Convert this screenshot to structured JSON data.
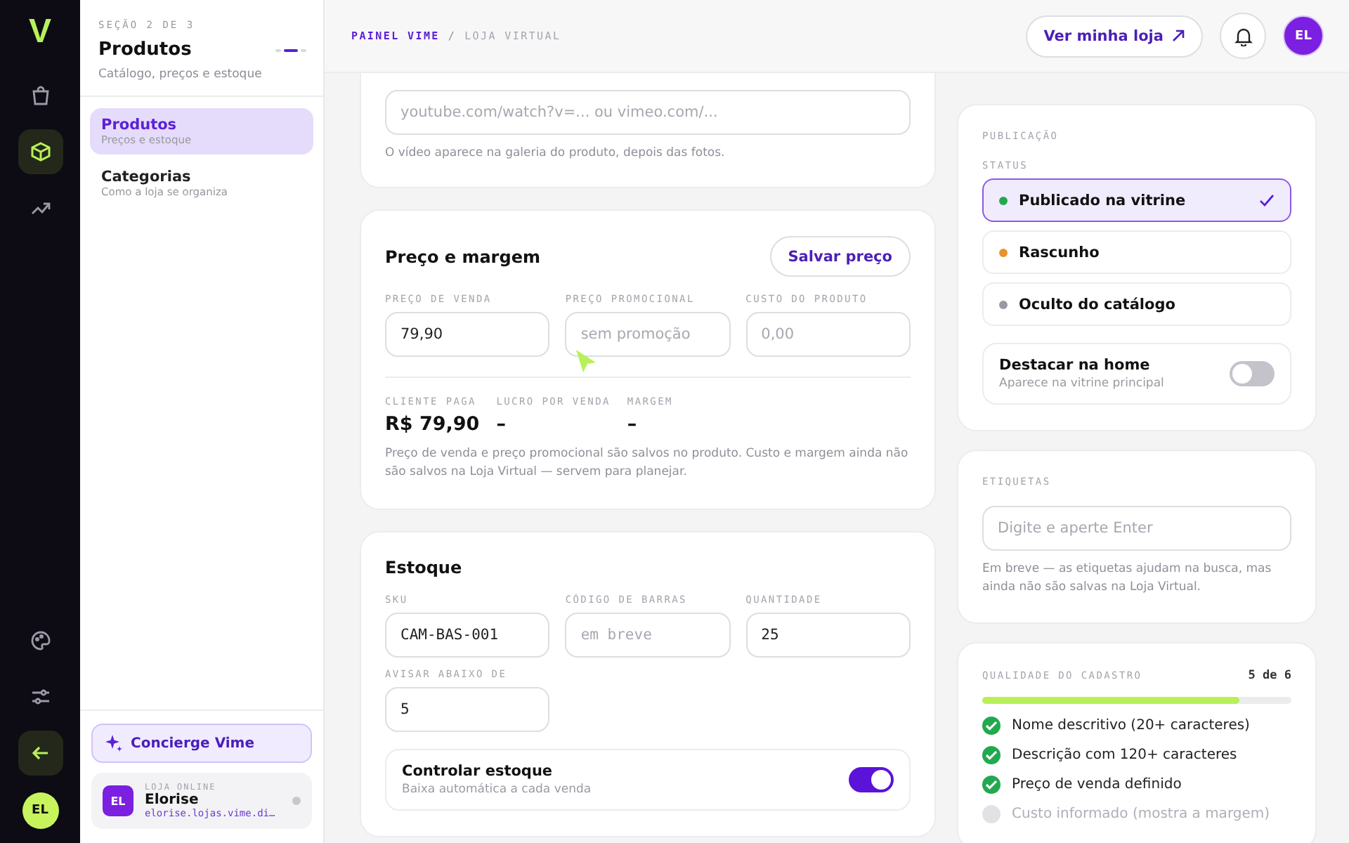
{
  "rail": {
    "logo": "V",
    "items": [
      {
        "kind": "bag",
        "selected": false
      },
      {
        "kind": "box",
        "selected": true
      },
      {
        "kind": "trend",
        "selected": false
      }
    ],
    "bottom_items": [
      {
        "kind": "palette",
        "selected": false
      },
      {
        "kind": "sliders",
        "selected": false
      },
      {
        "kind": "back",
        "selected": true
      }
    ],
    "avatar": "EL"
  },
  "sidebar": {
    "step": "SEÇÃO 2 DE 3",
    "title": "Produtos",
    "steps": [
      {
        "selected": false
      },
      {
        "selected": true
      },
      {
        "selected": false
      }
    ],
    "subtitle": "Catálogo, preços e estoque",
    "items": [
      {
        "label": "Produtos",
        "sub": "Preços e estoque",
        "selected": true
      },
      {
        "label": "Categorias",
        "sub": "Como a loja se organiza",
        "selected": false
      }
    ],
    "concierge": "Concierge Vime",
    "store": {
      "avatar": "EL",
      "kicker": "LOJA ONLINE",
      "name": "Elorise",
      "url": "elorise.lojas.vime.di…",
      "online": false
    }
  },
  "header": {
    "breadcrumb": [
      "PAINEL VIME",
      "/",
      "LOJA VIRTUAL"
    ],
    "view_store": "Ver minha loja",
    "avatar": "EL"
  },
  "video": {
    "placeholder": "youtube.com/watch?v=... ou vimeo.com/...",
    "help": "O vídeo aparece na galeria do produto, depois das fotos."
  },
  "price": {
    "title": "Preço e margem",
    "save": "Salvar preço",
    "fields": [
      {
        "label": "PREÇO DE VENDA",
        "value": "79,90"
      },
      {
        "label": "PREÇO PROMOCIONAL",
        "placeholder": "sem promoção"
      },
      {
        "label": "CUSTO DO PRODUTO",
        "placeholder": "0,00"
      }
    ],
    "stats": [
      {
        "label": "CLIENTE PAGA",
        "value": "R$ 79,90"
      },
      {
        "label": "LUCRO POR VENDA",
        "value": "–"
      },
      {
        "label": "MARGEM",
        "value": "–"
      }
    ],
    "note": "Preço de venda e preço promocional são salvos no produto. Custo e margem ainda não são salvos na Loja Virtual — servem para planejar."
  },
  "stock": {
    "title": "Estoque",
    "fields": [
      {
        "label": "SKU",
        "value": "CAM-BAS-001"
      },
      {
        "label": "CÓDIGO DE BARRAS",
        "placeholder": "em breve"
      },
      {
        "label": "QUANTIDADE",
        "value": "25"
      },
      {
        "label": "AVISAR ABAIXO DE",
        "value": "5"
      }
    ],
    "control": {
      "title": "Controlar estoque",
      "sub": "Baixa automática a cada venda",
      "on": true
    }
  },
  "publication": {
    "title": "PUBLICAÇÃO",
    "status_label": "STATUS",
    "statuses": [
      {
        "label": "Publicado na vitrine",
        "color": "#22a94f",
        "selected": true
      },
      {
        "label": "Rascunho",
        "color": "#e8922c",
        "selected": false
      },
      {
        "label": "Oculto do catálogo",
        "color": "#9a98a3",
        "selected": false
      }
    ],
    "highlight": {
      "title": "Destacar na home",
      "sub": "Aparece na vitrine principal",
      "on": false
    }
  },
  "tags": {
    "title": "ETIQUETAS",
    "placeholder": "Digite e aperte Enter",
    "help": "Em breve — as etiquetas ajudam na busca, mas ainda não são salvas na Loja Virtual."
  },
  "quality": {
    "title": "QUALIDADE DO CADASTRO",
    "count": "5 de 6",
    "level": 0.83,
    "items": [
      {
        "label": "Nome descritivo (20+ caracteres)",
        "checked": true
      },
      {
        "label": "Descrição com 120+ caracteres",
        "checked": true
      },
      {
        "label": "Preço de venda definido",
        "checked": true
      },
      {
        "label": "Custo informado (mostra a margem)",
        "checked": false
      }
    ]
  }
}
